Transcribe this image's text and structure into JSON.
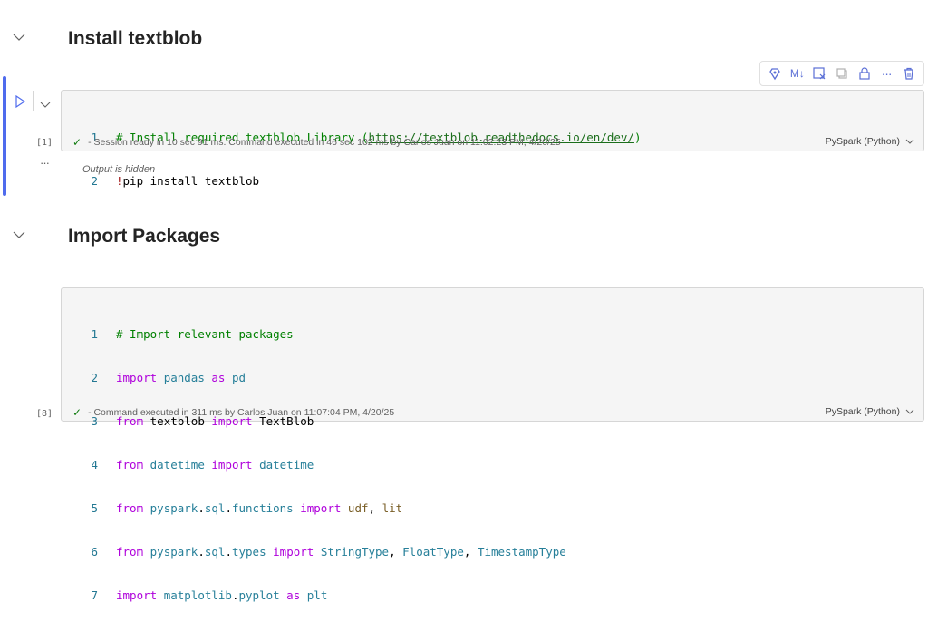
{
  "sections": [
    {
      "title": "Install textblob"
    },
    {
      "title": "Import Packages"
    }
  ],
  "toolbar": {
    "icons": [
      "copilot-icon",
      "markdown-icon",
      "clear-output-icon",
      "copy-icon",
      "lock-icon",
      "more-icon",
      "delete-icon"
    ],
    "markdown_label": "M↓",
    "more_label": "···"
  },
  "cell1": {
    "exec_count": "[1]",
    "lines": [
      {
        "num": "1",
        "comment_prefix": "# Install required textblob Library (",
        "url": "https://textblob.readthedocs.io/en/dev/",
        "comment_suffix": ")"
      },
      {
        "num": "2",
        "bang": "!",
        "rest": "pip install textblob"
      }
    ],
    "status": "- Session ready in 10 sec 91 ms. Command executed in 46 sec 102 ms by Carlos Juan on 11:02:23 PM, 4/20/25",
    "language": "PySpark (Python)",
    "output_collapsed": "···",
    "output_hidden": "Output is hidden"
  },
  "cell2": {
    "exec_count": "[8]",
    "nums": [
      "1",
      "2",
      "3",
      "4",
      "5",
      "6",
      "7"
    ],
    "tokens": {
      "l1_comment": "# Import relevant packages",
      "import": "import",
      "from": "from",
      "as": "as",
      "pandas": "pandas",
      "pd": "pd",
      "textblob": "textblob",
      "TextBlob": "TextBlob",
      "datetime_mod": "datetime",
      "datetime_cls": "datetime",
      "pyspark": "pyspark",
      "sql": "sql",
      "functions": "functions",
      "types": "types",
      "udf": "udf",
      "lit": "lit",
      "StringType": "StringType",
      "FloatType": "FloatType",
      "TimestampType": "TimestampType",
      "matplotlib": "matplotlib",
      "pyplot": "pyplot",
      "plt": "plt",
      "dot": ".",
      "comma": ", "
    },
    "status": "- Command executed in 311 ms by Carlos Juan on 11:07:04 PM, 4/20/25",
    "language": "PySpark (Python)"
  },
  "colors": {
    "accent": "#4f6bed",
    "success": "#107c10",
    "toolbar_icon": "#5b6fd6"
  }
}
